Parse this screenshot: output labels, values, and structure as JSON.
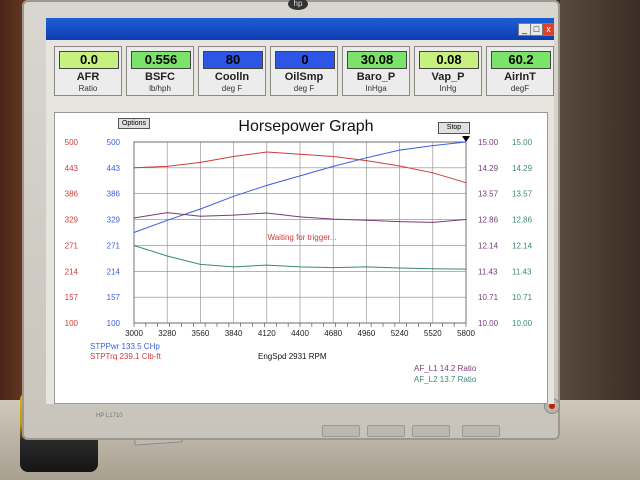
{
  "monitor": {
    "brand_mark": "hp",
    "model": "HP L1710"
  },
  "window": {
    "min": "_",
    "max": "□",
    "close": "x"
  },
  "gauges": [
    {
      "value": "0.0",
      "label": "AFR",
      "unit": "Ratio",
      "color": "#c8f080"
    },
    {
      "value": "0.556",
      "label": "BSFC",
      "unit": "lb/hph",
      "color": "#7be36a"
    },
    {
      "value": "80",
      "label": "Coolln",
      "unit": "deg F",
      "color": "#2d55e6"
    },
    {
      "value": "0",
      "label": "OilSmp",
      "unit": "deg F",
      "color": "#2d55e6"
    },
    {
      "value": "30.08",
      "label": "Baro_P",
      "unit": "InHga",
      "color": "#7be36a"
    },
    {
      "value": "0.08",
      "label": "Vap_P",
      "unit": "InHg",
      "color": "#c8f080"
    },
    {
      "value": "60.2",
      "label": "AirInT",
      "unit": "degF",
      "color": "#7be36a"
    }
  ],
  "graph": {
    "options_label": "Options",
    "stop_label": "Stop",
    "title": "Horsepower Graph",
    "status": "Waiting for trigger..."
  },
  "footer": {
    "stpp": "STPPwr 133.5 CHp",
    "stptq": "STPTrq 239.1 Clb-ft",
    "engspd": "EngSpd 2931 RPM",
    "af1": "AF_L1  14.2 Ratio",
    "af2": "AF_L2  13.7 Ratio"
  },
  "chart_data": {
    "type": "line",
    "x": [
      3000,
      3280,
      3560,
      3840,
      4120,
      4400,
      4680,
      4960,
      5240,
      5520,
      5800
    ],
    "xlabel": "EngSpd 2931 RPM",
    "xlim": [
      3000,
      5800
    ],
    "left_axis_red_ticks": [
      "500",
      "443",
      "386",
      "329",
      "271",
      "214",
      "157",
      "100"
    ],
    "left_axis_blue_ticks": [
      "500",
      "443",
      "386",
      "329",
      "271",
      "214",
      "157",
      "100"
    ],
    "right_axis_ticks": [
      "15.00",
      "14.29",
      "13.57",
      "12.86",
      "12.14",
      "11.43",
      "10.71",
      "10.00"
    ],
    "ylim_left": [
      100,
      500
    ],
    "ylim_right": [
      10.0,
      15.0
    ],
    "series": [
      {
        "name": "STPPwr",
        "color": "#3a5fe0",
        "axis": "left",
        "values": [
          300,
          327,
          352,
          380,
          404,
          425,
          446,
          465,
          482,
          492,
          500
        ]
      },
      {
        "name": "STPTrq",
        "color": "#d23a3a",
        "axis": "left",
        "values": [
          443,
          446,
          455,
          468,
          478,
          473,
          468,
          459,
          447,
          432,
          410
        ]
      },
      {
        "name": "AF_L1",
        "color": "#7a3a7a",
        "axis": "right",
        "values": [
          12.9,
          13.05,
          12.95,
          12.98,
          13.04,
          12.93,
          12.87,
          12.84,
          12.8,
          12.78,
          12.86
        ]
      },
      {
        "name": "AF_L2",
        "color": "#3a8a7a",
        "axis": "right",
        "values": [
          12.14,
          11.85,
          11.62,
          11.55,
          11.6,
          11.55,
          11.53,
          11.55,
          11.52,
          11.5,
          11.49
        ]
      }
    ]
  }
}
